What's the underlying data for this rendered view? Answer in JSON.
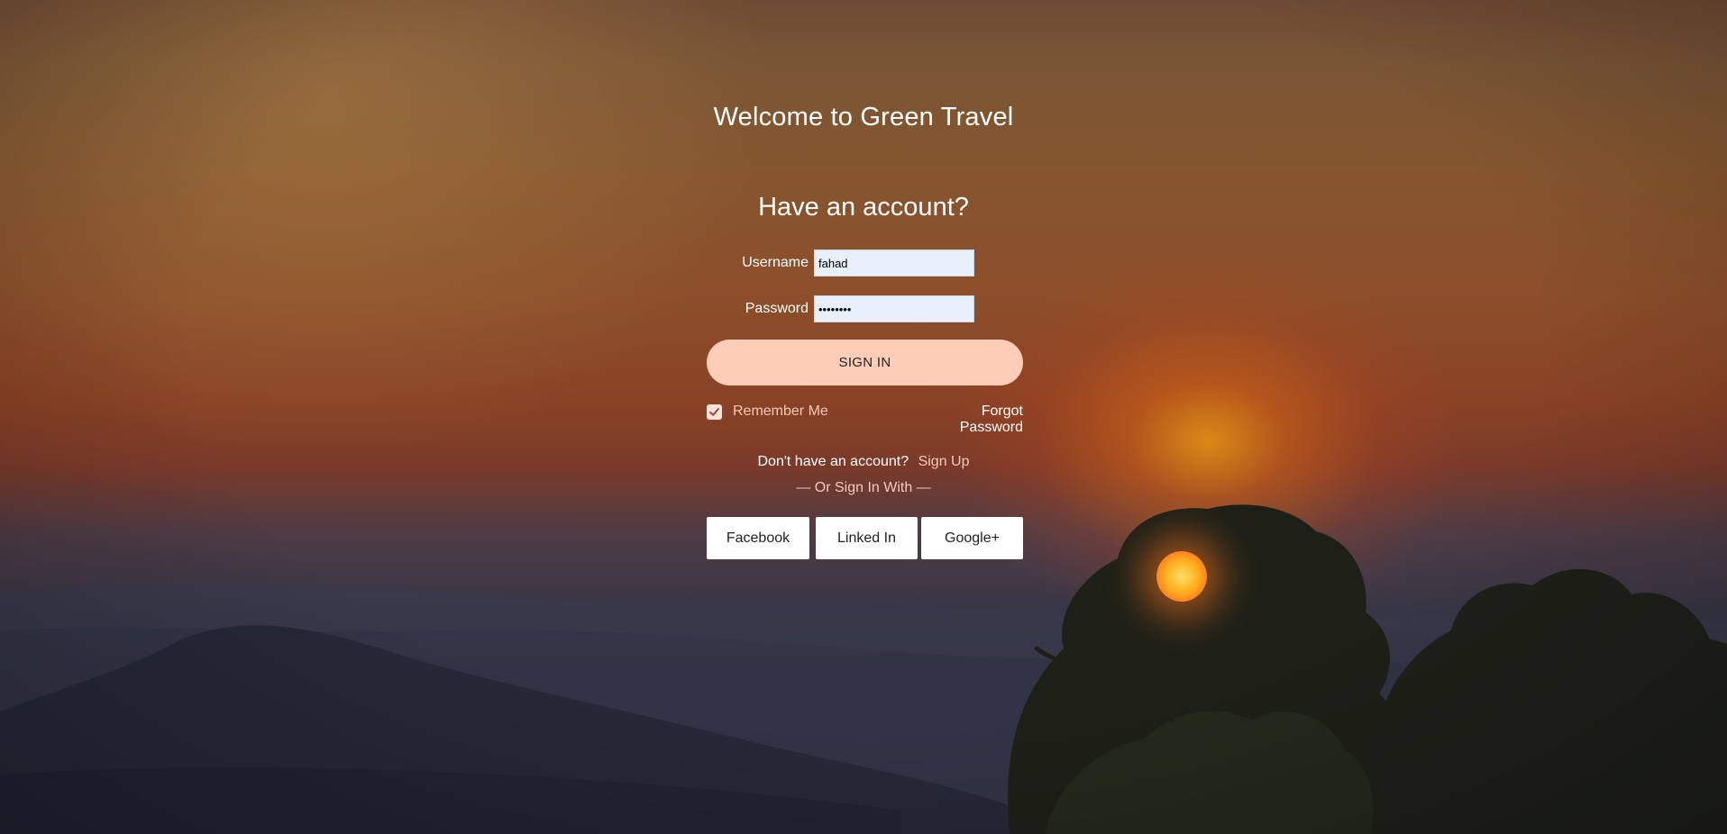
{
  "page": {
    "site_title": "Welcome to Green Travel",
    "heading": "Have an account?"
  },
  "form": {
    "username_label": "Username",
    "username_value": "fahad",
    "password_label": "Password",
    "password_value": "••••••••",
    "signin_label": "SIGN IN",
    "remember_label": "Remember Me",
    "remember_checked": true,
    "forgot_label": "Forgot Password"
  },
  "signup": {
    "prompt": "Don't have an account?",
    "link": "Sign Up"
  },
  "social": {
    "divider": "— Or Sign In With —",
    "buttons": [
      "Facebook",
      "Linked In",
      "Google+"
    ]
  },
  "colors": {
    "button_peach": "#fdcdb8",
    "accent_text": "#f7cbb8",
    "input_bg": "#e8f0fe"
  }
}
